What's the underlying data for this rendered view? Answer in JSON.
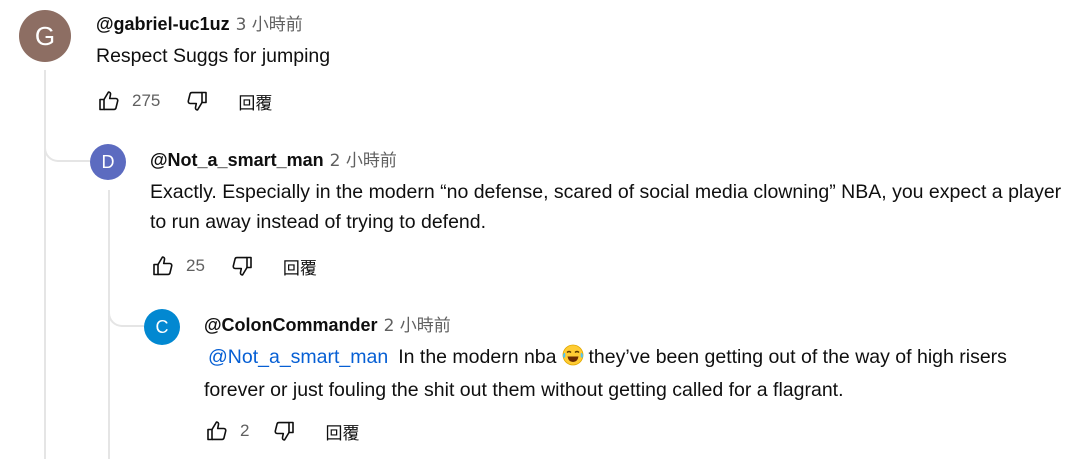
{
  "comments": [
    {
      "avatar_letter": "G",
      "avatar_color": "#8d6e63",
      "author": "@gabriel-uc1uz",
      "time": "3 小時前",
      "text": "Respect Suggs for jumping",
      "likes": "275",
      "reply_label": "回覆"
    },
    {
      "avatar_letter": "D",
      "avatar_color": "#5c6bc0",
      "author": "@Not_a_smart_man",
      "time": "2 小時前",
      "text": "Exactly. Especially in the modern “no defense, scared of social media clowning” NBA, you expect a player to run away instead of trying to defend.",
      "likes": "25",
      "reply_label": "回覆"
    },
    {
      "avatar_letter": "C",
      "avatar_color": "#0288d1",
      "author": "@ColonCommander",
      "time": "2 小時前",
      "mention": "@Not_a_smart_man",
      "text_before_emoji": "In the modern nba",
      "text_after_emoji": "they’ve been getting out of the way of high risers forever or just fouling the shit out them without getting called for a flagrant.",
      "emoji_icon": "face-with-tears-of-joy-icon",
      "likes": "2",
      "reply_label": "回覆"
    }
  ]
}
